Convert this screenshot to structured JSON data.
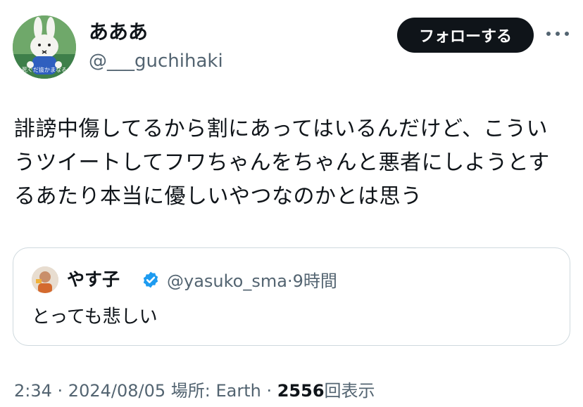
{
  "author": {
    "display_name": "あああ",
    "handle": "@___guchihaki",
    "avatar_caption": "死ぐだ抜かまなる"
  },
  "follow_label": "フォローする",
  "more_icon": "more-horizontal-icon",
  "tweet_text": "誹謗中傷してるから割にあってはいるんだけど、こういうツイートしてフワちゃんをちゃんと悪者にしようとするあたり本当に優しいやつなのかとは思う",
  "quote": {
    "name": "やす子",
    "verified_icon": "verified-badge-icon",
    "handle": "@yasuko_sma",
    "separator": "·",
    "time": "9時間",
    "text": "とっても悲しい"
  },
  "footer": {
    "time": "2:34",
    "sep1": " · ",
    "date": "2024/08/05",
    "location": " 場所: Earth",
    "sep2": " · ",
    "views_count": "2556",
    "views_label": "回表示"
  },
  "colors": {
    "text": "#0f1419",
    "secondary": "#536471",
    "verified": "#1d9bf0",
    "border": "#cfd9de"
  }
}
